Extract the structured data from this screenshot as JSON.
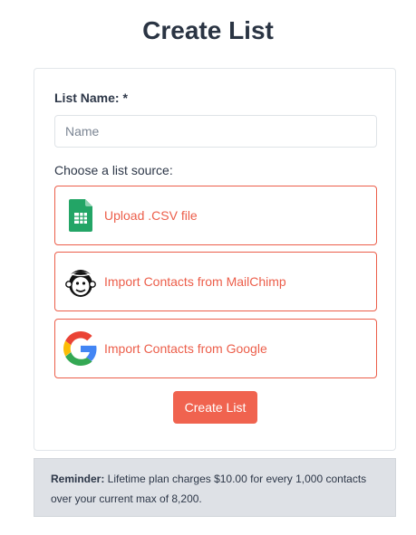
{
  "page": {
    "title": "Create List"
  },
  "form": {
    "name_label": "List Name: *",
    "name_placeholder": "Name",
    "name_value": "",
    "source_label": "Choose a list source:",
    "sources": [
      {
        "label": "Upload .CSV file",
        "icon": "spreadsheet-icon"
      },
      {
        "label": "Import Contacts from MailChimp",
        "icon": "mailchimp-icon"
      },
      {
        "label": "Import Contacts from Google",
        "icon": "google-icon"
      }
    ],
    "submit_label": "Create List"
  },
  "reminder": {
    "prefix": "Reminder:",
    "text": " Lifetime plan charges $10.00 for every 1,000 contacts over your current max of 8,200."
  },
  "colors": {
    "accent": "#f0634f",
    "option_border": "#ec5e4a",
    "title": "#2a3443",
    "reminder_bg": "#dee1e6"
  }
}
